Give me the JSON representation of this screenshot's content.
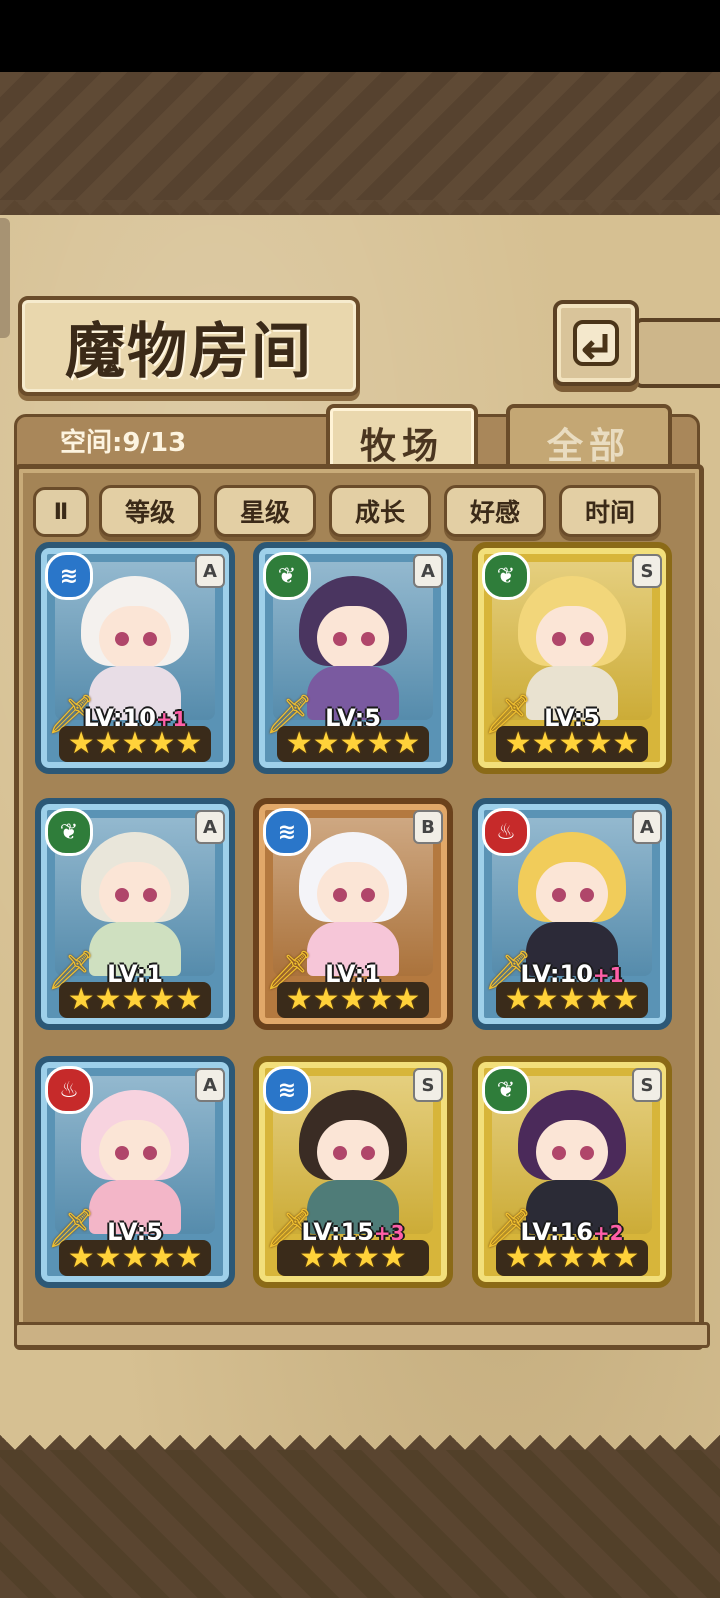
{
  "page": {
    "title": "魔物房间"
  },
  "header": {
    "space_label": "空间:9/13"
  },
  "tabs": [
    {
      "label": "牧场",
      "active": true
    },
    {
      "label": "全部",
      "active": false
    }
  ],
  "sort": {
    "toggle_label": "Ⅱ",
    "buttons": [
      "等级",
      "星级",
      "成长",
      "好感",
      "时间"
    ]
  },
  "icons": {
    "back": "back-arrow-icon",
    "water": "water-element-icon",
    "wind": "wind-element-icon",
    "fire": "fire-element-icon",
    "sword": "sword-icon",
    "star": "star-icon"
  },
  "colors": {
    "water": "#2a76c9",
    "wind": "#2f7d3a",
    "fire": "#c62a2a",
    "gold_frame": "#d7b53a",
    "blue_frame": "#5a93b5",
    "bronze_frame": "#b4793f"
  },
  "monsters": [
    {
      "element": "water",
      "rank": "A",
      "level": "LV:10",
      "bonus": "+1",
      "stars": 5,
      "frame": "blue"
    },
    {
      "element": "wind",
      "rank": "A",
      "level": "LV:5",
      "bonus": "",
      "stars": 5,
      "frame": "blue"
    },
    {
      "element": "wind",
      "rank": "S",
      "level": "LV:5",
      "bonus": "",
      "stars": 5,
      "frame": "gold"
    },
    {
      "element": "wind",
      "rank": "A",
      "level": "LV:1",
      "bonus": "",
      "stars": 5,
      "frame": "blue"
    },
    {
      "element": "water",
      "rank": "B",
      "level": "LV:1",
      "bonus": "",
      "stars": 5,
      "frame": "bronze"
    },
    {
      "element": "fire",
      "rank": "A",
      "level": "LV:10",
      "bonus": "+1",
      "stars": 5,
      "frame": "blue"
    },
    {
      "element": "fire",
      "rank": "A",
      "level": "LV:5",
      "bonus": "",
      "stars": 5,
      "frame": "blue"
    },
    {
      "element": "water",
      "rank": "S",
      "level": "LV:15",
      "bonus": "+3",
      "stars": 4,
      "frame": "gold"
    },
    {
      "element": "wind",
      "rank": "S",
      "level": "LV:16",
      "bonus": "+2",
      "stars": 5,
      "frame": "gold"
    }
  ]
}
